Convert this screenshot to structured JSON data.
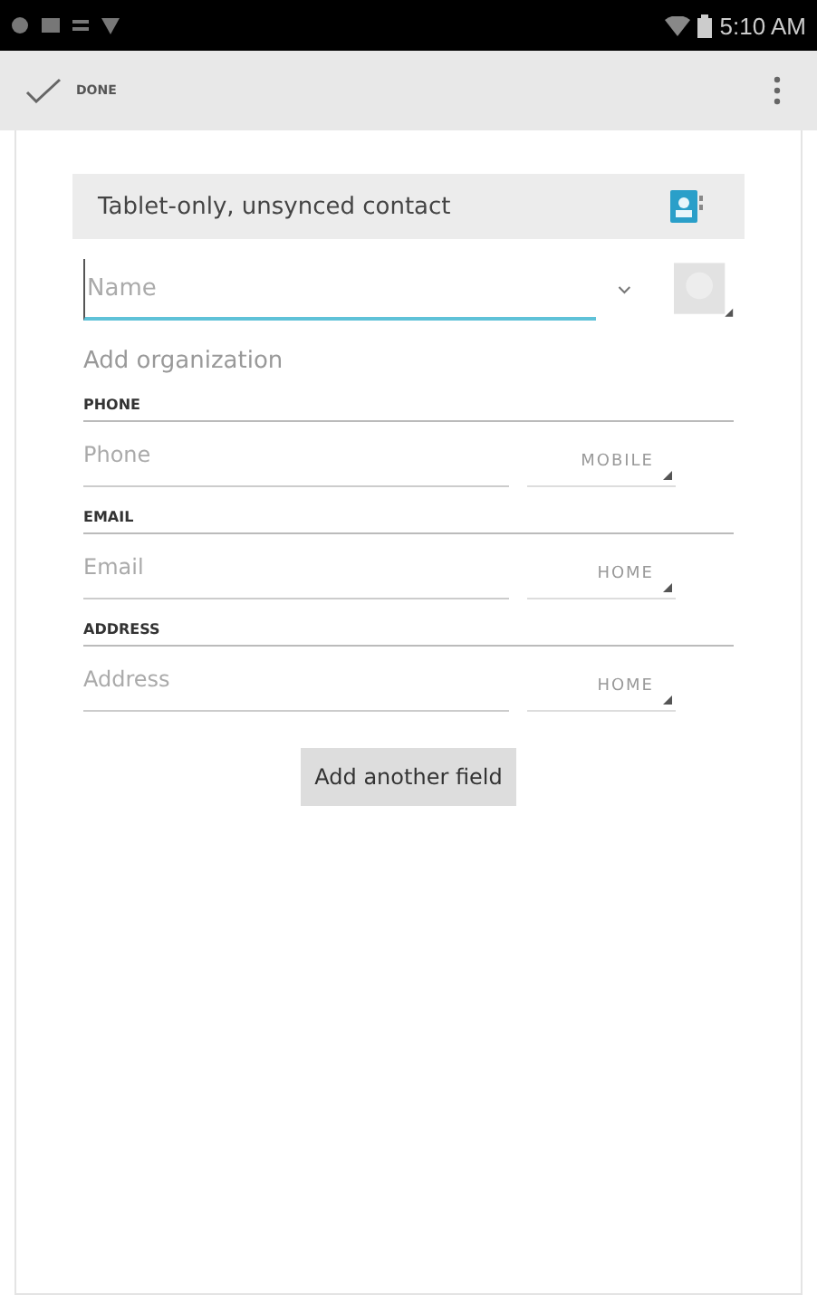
{
  "status_bar": {
    "time": "5:10 AM"
  },
  "action_bar": {
    "done_label": "DONE"
  },
  "account": {
    "label": "Tablet-only, unsynced contact"
  },
  "name_field": {
    "placeholder": "Name",
    "focused": true
  },
  "add_organization": "Add organization",
  "sections": [
    {
      "header": "PHONE",
      "placeholder": "Phone",
      "type": "MOBILE"
    },
    {
      "header": "EMAIL",
      "placeholder": "Email",
      "type": "HOME"
    },
    {
      "header": "ADDRESS",
      "placeholder": "Address",
      "type": "HOME"
    }
  ],
  "add_field_button": "Add another field"
}
